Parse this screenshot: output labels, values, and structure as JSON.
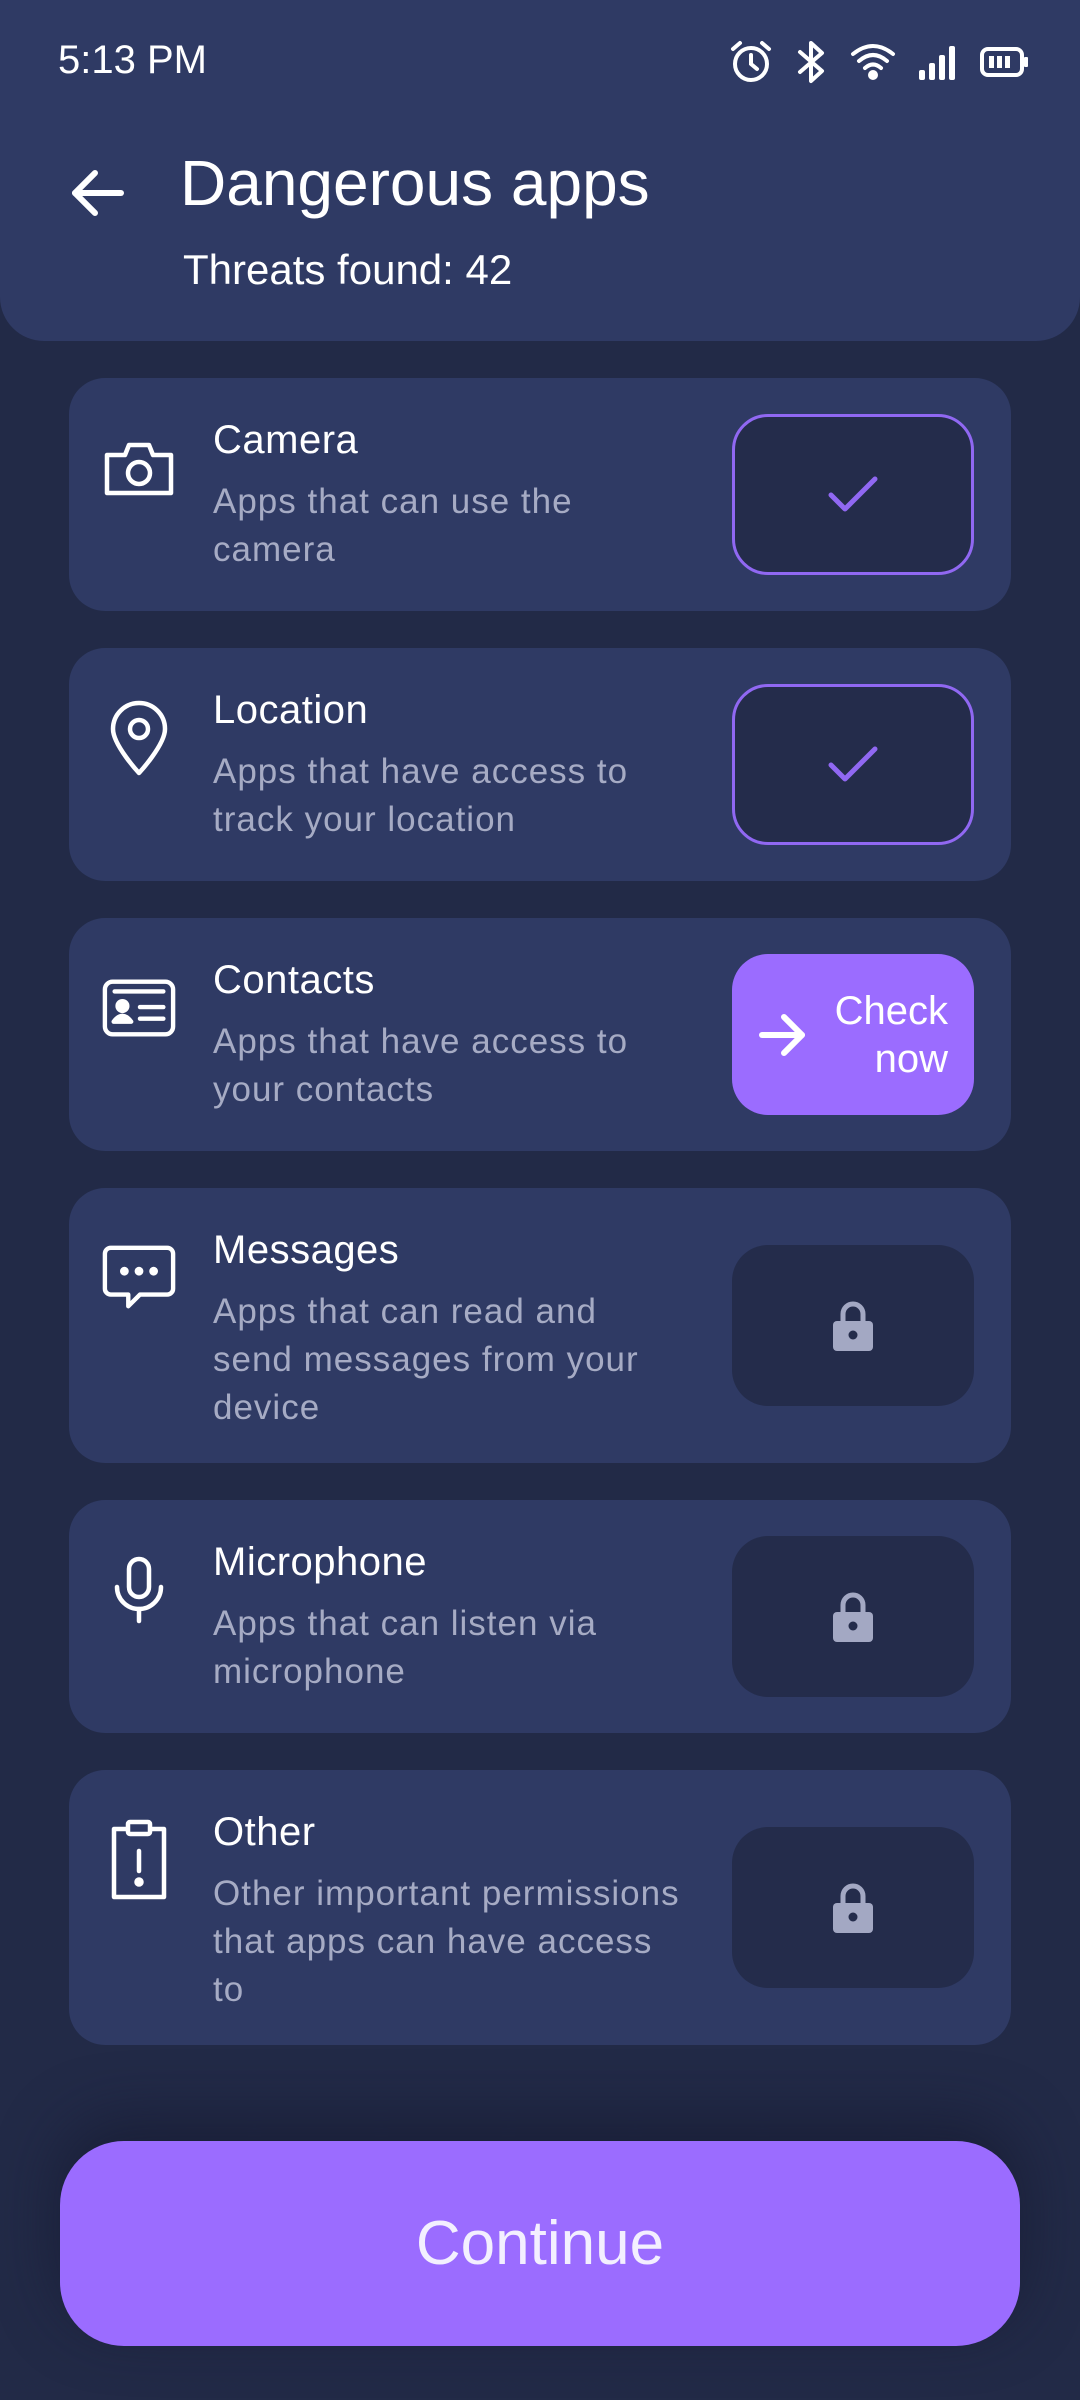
{
  "status_bar": {
    "time": "5:13 PM",
    "icons": [
      "alarm-icon",
      "bluetooth-icon",
      "wifi-icon",
      "signal-icon",
      "battery-icon"
    ]
  },
  "header": {
    "back_icon": "arrow-left-icon",
    "title": "Dangerous apps",
    "subtitle": "Threats found: 42"
  },
  "categories": [
    {
      "icon": "camera-icon",
      "title": "Camera",
      "description": "Apps that can use the camera",
      "state": "done"
    },
    {
      "icon": "location-pin-icon",
      "title": "Location",
      "description": "Apps that have access to track your location",
      "state": "done"
    },
    {
      "icon": "contact-card-icon",
      "title": "Contacts",
      "description": "Apps that have access to your contacts",
      "state": "check",
      "action_label": "Check now"
    },
    {
      "icon": "message-bubble-icon",
      "title": "Messages",
      "description": "Apps that can read and send messages from your device",
      "state": "locked"
    },
    {
      "icon": "microphone-icon",
      "title": "Microphone",
      "description": "Apps that can listen via microphone",
      "state": "locked"
    },
    {
      "icon": "clipboard-alert-icon",
      "title": "Other",
      "description": "Other important permissions that apps can have access to",
      "state": "locked"
    }
  ],
  "continue_label": "Continue",
  "colors": {
    "background": "#222a47",
    "card": "#2f3a64",
    "accent": "#9b6cff",
    "muted_text": "#a6abc4"
  }
}
